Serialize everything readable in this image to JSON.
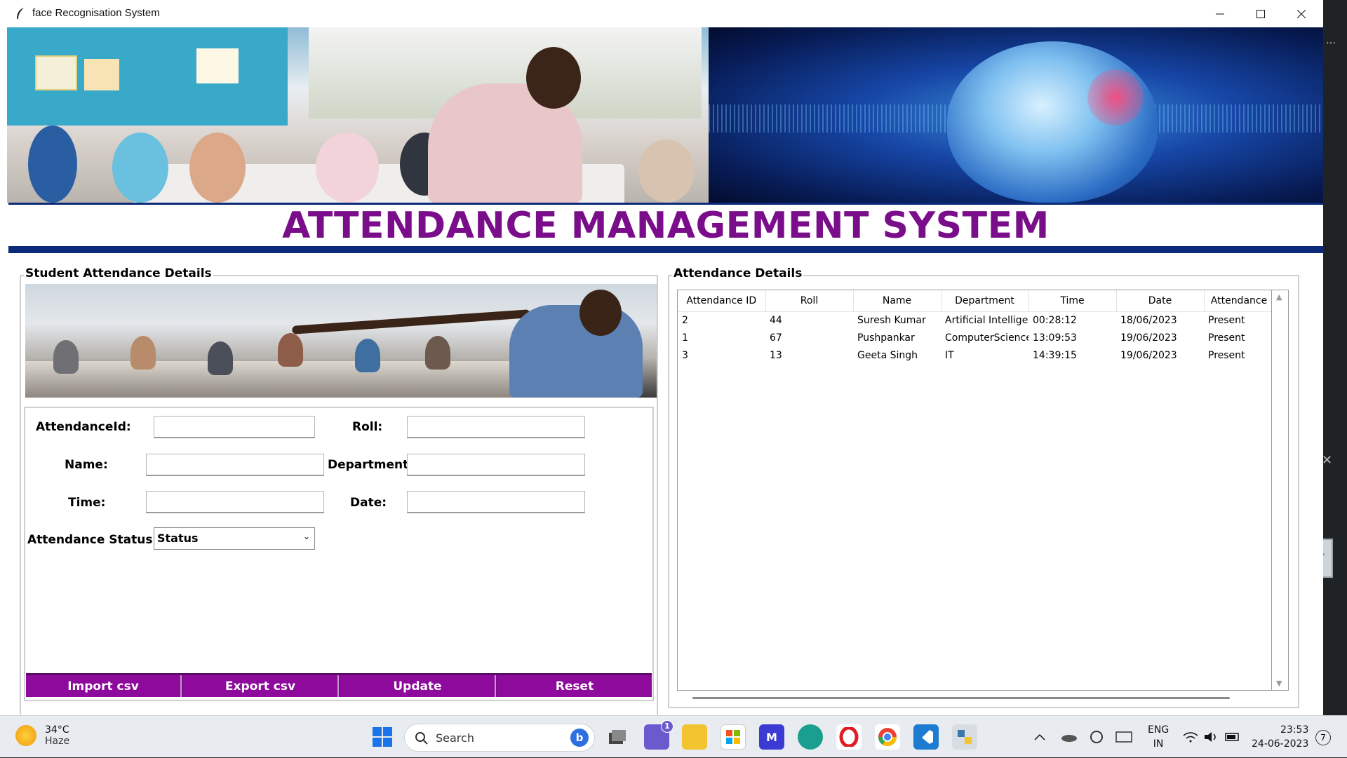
{
  "window": {
    "title": "face Recognisation System"
  },
  "header": {
    "title": "ATTENDANCE MANAGEMENT SYSTEM"
  },
  "left_panel": {
    "label": "Student Attendance Details",
    "fields": {
      "attendance_id": {
        "label": "AttendanceId:",
        "value": ""
      },
      "roll": {
        "label": "Roll:",
        "value": ""
      },
      "name": {
        "label": "Name:",
        "value": ""
      },
      "department": {
        "label": "Department:",
        "value": ""
      },
      "time": {
        "label": "Time:",
        "value": ""
      },
      "date": {
        "label": "Date:",
        "value": ""
      },
      "status": {
        "label": "Attendance Status:",
        "selected": "Status"
      }
    },
    "buttons": {
      "import": "Import csv",
      "export": "Export csv",
      "update": "Update",
      "reset": "Reset"
    }
  },
  "right_panel": {
    "label": "Attendance Details",
    "columns": [
      "Attendance ID",
      "Roll",
      "Name",
      "Department",
      "Time",
      "Date",
      "Attendance"
    ],
    "rows": [
      [
        "2",
        "44",
        "Suresh Kumar",
        "Artificial Intelligen",
        "00:28:12",
        "18/06/2023",
        "Present"
      ],
      [
        "1",
        "67",
        "Pushpankar",
        "ComputerScience",
        "13:09:53",
        "19/06/2023",
        "Present"
      ],
      [
        "3",
        "13",
        "Geeta Singh",
        "IT",
        "14:39:15",
        "19/06/2023",
        "Present"
      ]
    ]
  },
  "taskbar": {
    "weather": {
      "temp": "34°C",
      "condition": "Haze"
    },
    "search_label": "Search",
    "chat_badge": "1",
    "lang": {
      "line1": "ENG",
      "line2": "IN"
    },
    "clock": {
      "time": "23:53",
      "date": "24-06-2023"
    },
    "notifications": "7"
  },
  "colors": {
    "accent": "#7a0d8a",
    "band": "#0b2a7a"
  }
}
